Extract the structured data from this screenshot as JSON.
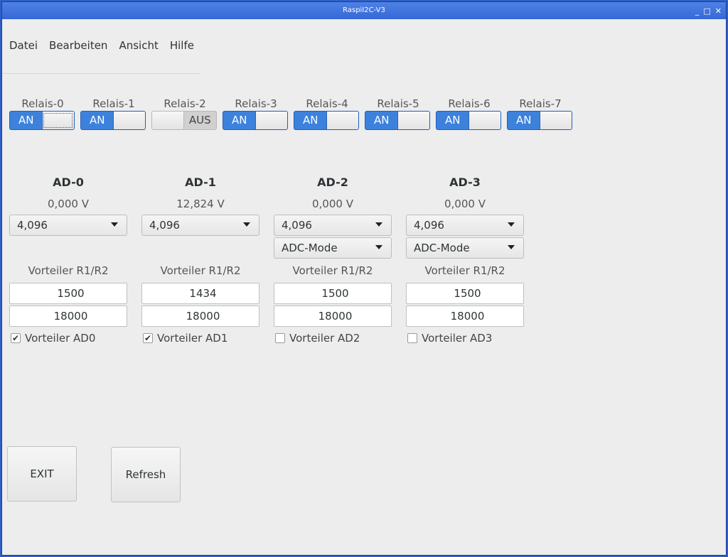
{
  "window": {
    "title": "RaspiI2C-V3",
    "min_icon": "minimize-icon",
    "max_icon": "maximize-icon",
    "close_icon": "close-icon"
  },
  "menu": [
    "Datei",
    "Bearbeiten",
    "Ansicht",
    "Hilfe"
  ],
  "relais": [
    {
      "label": "Relais-0",
      "state": "AN",
      "on": true
    },
    {
      "label": "Relais-1",
      "state": "AN",
      "on": true
    },
    {
      "label": "Relais-2",
      "state": "AUS",
      "on": false
    },
    {
      "label": "Relais-3",
      "state": "AN",
      "on": true
    },
    {
      "label": "Relais-4",
      "state": "AN",
      "on": true
    },
    {
      "label": "Relais-5",
      "state": "AN",
      "on": true
    },
    {
      "label": "Relais-6",
      "state": "AN",
      "on": true
    },
    {
      "label": "Relais-7",
      "state": "AN",
      "on": true
    }
  ],
  "adc": [
    {
      "title": "AD-0",
      "value": "0,000 V",
      "range": "4,096",
      "mode": null,
      "divider_label": "Vorteiler R1/R2",
      "r1": "1500",
      "r2": "18000",
      "check_label": "Vorteiler AD0",
      "checked": true
    },
    {
      "title": "AD-1",
      "value": "12,824 V",
      "range": "4,096",
      "mode": null,
      "divider_label": "Vorteiler R1/R2",
      "r1": "1434",
      "r2": "18000",
      "check_label": "Vorteiler AD1",
      "checked": true
    },
    {
      "title": "AD-2",
      "value": "0,000 V",
      "range": "4,096",
      "mode": "ADC-Mode",
      "divider_label": "Vorteiler R1/R2",
      "r1": "1500",
      "r2": "18000",
      "check_label": "Vorteiler AD2",
      "checked": false
    },
    {
      "title": "AD-3",
      "value": "0,000 V",
      "range": "4,096",
      "mode": "ADC-Mode",
      "divider_label": "Vorteiler R1/R2",
      "r1": "1500",
      "r2": "18000",
      "check_label": "Vorteiler AD3",
      "checked": false
    }
  ],
  "buttons": {
    "exit": "EXIT",
    "refresh": "Refresh"
  },
  "colors": {
    "accent": "#3c82dd",
    "titlebar": "#3568d6",
    "background": "#ededed"
  }
}
